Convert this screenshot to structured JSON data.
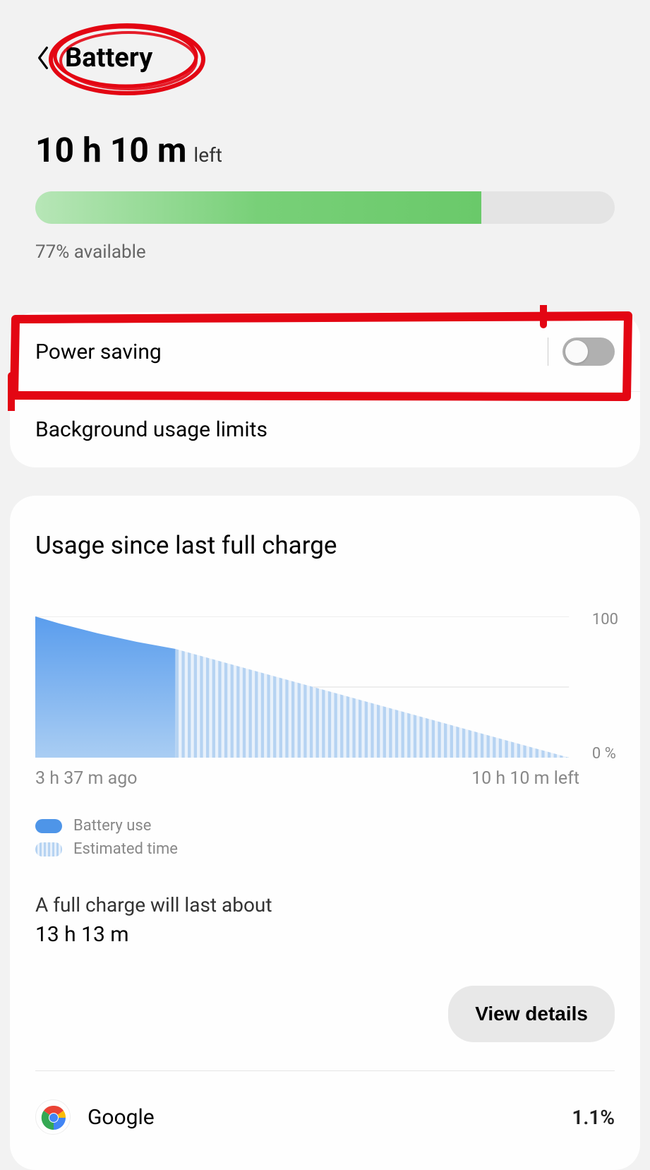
{
  "header": {
    "title": "Battery"
  },
  "summary": {
    "time_remaining": "10 h 10 m",
    "time_suffix": "left",
    "percent_available_text": "77% available",
    "percent_fill": 77
  },
  "settings": {
    "power_saving_label": "Power saving",
    "power_saving_on": false,
    "background_limits_label": "Background usage limits"
  },
  "usage": {
    "title": "Usage since last full charge",
    "y_top": "100",
    "y_bottom": "0 %",
    "x_left": "3 h 37 m ago",
    "x_right": "10 h 10 m left",
    "legend_battery": "Battery use",
    "legend_estimated": "Estimated time",
    "full_charge_text": "A full charge will last about",
    "full_charge_time": "13 h 13 m",
    "view_details": "View details"
  },
  "apps": [
    {
      "name": "Google",
      "percent": "1.1%"
    }
  ],
  "chart_data": {
    "type": "area",
    "ylim": [
      0,
      100
    ],
    "ylabel": "%",
    "xlabel": "",
    "x_range_hours": {
      "past": 3.62,
      "future": 10.17
    },
    "series": [
      {
        "name": "Battery use",
        "kind": "actual",
        "points": [
          {
            "t_h": -3.62,
            "pct": 100
          },
          {
            "t_h": -3.0,
            "pct": 95
          },
          {
            "t_h": -2.0,
            "pct": 88
          },
          {
            "t_h": -1.0,
            "pct": 82
          },
          {
            "t_h": 0.0,
            "pct": 77
          }
        ]
      },
      {
        "name": "Estimated time",
        "kind": "estimated",
        "points": [
          {
            "t_h": 0.0,
            "pct": 77
          },
          {
            "t_h": 10.17,
            "pct": 0
          }
        ]
      }
    ]
  }
}
